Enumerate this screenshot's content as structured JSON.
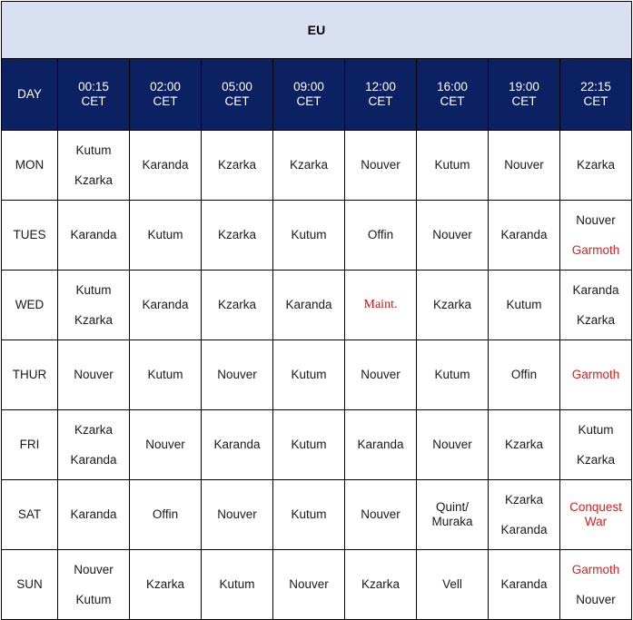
{
  "region": {
    "title": "EU"
  },
  "columns": {
    "day_label": "DAY",
    "times": [
      {
        "time": "00:15",
        "zone": "CET"
      },
      {
        "time": "02:00",
        "zone": "CET"
      },
      {
        "time": "05:00",
        "zone": "CET"
      },
      {
        "time": "09:00",
        "zone": "CET"
      },
      {
        "time": "12:00",
        "zone": "CET"
      },
      {
        "time": "16:00",
        "zone": "CET"
      },
      {
        "time": "19:00",
        "zone": "CET"
      },
      {
        "time": "22:15",
        "zone": "CET"
      }
    ]
  },
  "colors": {
    "header_navy": "#0c2161",
    "region_band": "#d9e0f2",
    "day_column": "#d4dcef",
    "highlight_cream": "#fdeed0",
    "special_red": "#e01b1b",
    "grid_line": "#000000",
    "cell_text": "#1a1a1a"
  },
  "rows": [
    {
      "day": "MON",
      "cells": [
        {
          "lines": [
            "Kutum",
            "Kzarka"
          ],
          "highlight": true
        },
        {
          "lines": [
            "Karanda"
          ]
        },
        {
          "lines": [
            "Kzarka"
          ]
        },
        {
          "lines": [
            "Kzarka"
          ]
        },
        {
          "lines": [
            "Nouver"
          ]
        },
        {
          "lines": [
            "Kutum"
          ]
        },
        {
          "lines": [
            "Nouver"
          ]
        },
        {
          "lines": [
            "Kzarka"
          ]
        }
      ]
    },
    {
      "day": "TUES",
      "cells": [
        {
          "lines": [
            "Karanda"
          ]
        },
        {
          "lines": [
            "Kutum"
          ]
        },
        {
          "lines": [
            "Kzarka"
          ]
        },
        {
          "lines": [
            "Kutum"
          ]
        },
        {
          "lines": [
            "Offin"
          ]
        },
        {
          "lines": [
            "Nouver"
          ]
        },
        {
          "lines": [
            "Karanda"
          ]
        },
        {
          "lines": [
            "Nouver",
            "Garmoth"
          ],
          "red_lines": [
            1
          ]
        }
      ]
    },
    {
      "day": "WED",
      "cells": [
        {
          "lines": [
            "Kutum",
            "Kzarka"
          ],
          "highlight": true
        },
        {
          "lines": [
            "Karanda"
          ]
        },
        {
          "lines": [
            "Kzarka"
          ]
        },
        {
          "lines": [
            "Karanda"
          ]
        },
        {
          "lines": [
            "Maint."
          ],
          "maint_lines": [
            0
          ]
        },
        {
          "lines": [
            "Kzarka"
          ]
        },
        {
          "lines": [
            "Kutum"
          ]
        },
        {
          "lines": [
            "Karanda",
            "Kzarka"
          ]
        }
      ]
    },
    {
      "day": "THUR",
      "cells": [
        {
          "lines": [
            "Nouver"
          ]
        },
        {
          "lines": [
            "Kutum"
          ]
        },
        {
          "lines": [
            "Nouver"
          ]
        },
        {
          "lines": [
            "Kutum"
          ]
        },
        {
          "lines": [
            "Nouver"
          ]
        },
        {
          "lines": [
            "Kutum"
          ]
        },
        {
          "lines": [
            "Offin"
          ]
        },
        {
          "lines": [
            "Garmoth"
          ],
          "red_lines": [
            0
          ]
        }
      ]
    },
    {
      "day": "FRI",
      "cells": [
        {
          "lines": [
            "Kzarka",
            "Karanda"
          ],
          "highlight": true
        },
        {
          "lines": [
            "Nouver"
          ]
        },
        {
          "lines": [
            "Karanda"
          ]
        },
        {
          "lines": [
            "Kutum"
          ]
        },
        {
          "lines": [
            "Karanda"
          ]
        },
        {
          "lines": [
            "Nouver"
          ]
        },
        {
          "lines": [
            "Kzarka"
          ]
        },
        {
          "lines": [
            "Kutum",
            "Kzarka"
          ]
        }
      ]
    },
    {
      "day": "SAT",
      "cells": [
        {
          "lines": [
            "Karanda"
          ]
        },
        {
          "lines": [
            "Offin"
          ]
        },
        {
          "lines": [
            "Nouver"
          ]
        },
        {
          "lines": [
            "Kutum"
          ]
        },
        {
          "lines": [
            "Nouver"
          ]
        },
        {
          "lines": [
            "Quint/",
            "Muraka"
          ],
          "tight": true
        },
        {
          "lines": [
            "Kzarka",
            "Karanda"
          ]
        },
        {
          "lines": [
            "Conquest",
            "War"
          ],
          "red_lines": [
            0,
            1
          ],
          "tight": true
        }
      ]
    },
    {
      "day": "SUN",
      "cells": [
        {
          "lines": [
            "Nouver",
            "Kutum"
          ]
        },
        {
          "lines": [
            "Kzarka"
          ]
        },
        {
          "lines": [
            "Kutum"
          ]
        },
        {
          "lines": [
            "Nouver"
          ]
        },
        {
          "lines": [
            "Kzarka"
          ]
        },
        {
          "lines": [
            "Vell"
          ]
        },
        {
          "lines": [
            "Karanda"
          ]
        },
        {
          "lines": [
            "Garmoth",
            "Nouver"
          ],
          "red_lines": [
            0
          ]
        }
      ]
    }
  ]
}
